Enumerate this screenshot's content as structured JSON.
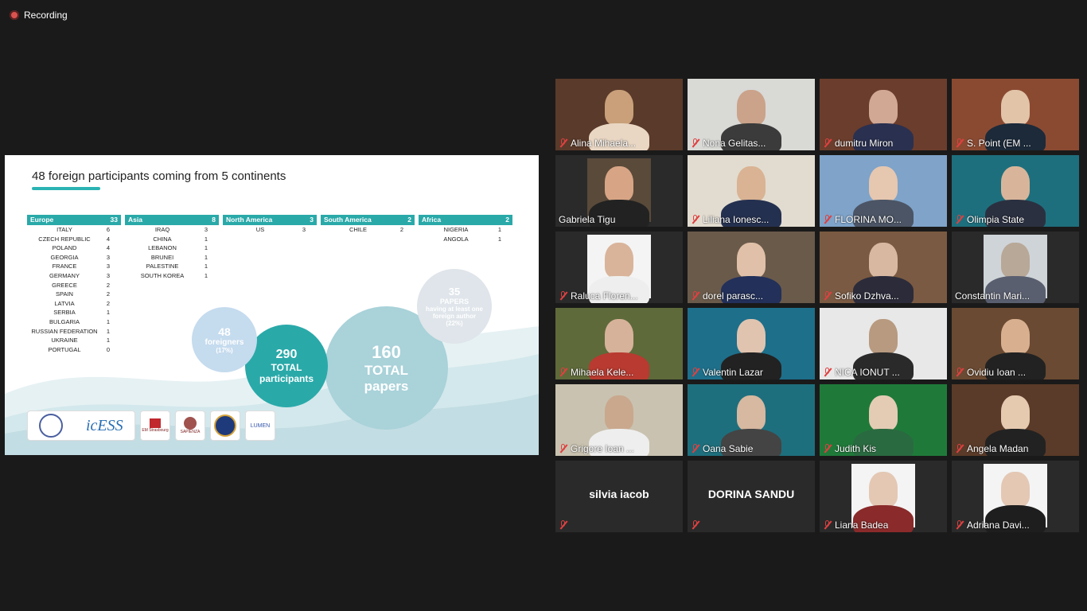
{
  "recording": {
    "label": "Recording",
    "color": "#d9534f"
  },
  "slide": {
    "title": "48 foreign participants coming from 5 continents",
    "regions": [
      {
        "name": "Europe",
        "total": "33",
        "countries": [
          {
            "name": "ITALY",
            "count": "6"
          },
          {
            "name": "CZECH REPUBLIC",
            "count": "4"
          },
          {
            "name": "POLAND",
            "count": "4"
          },
          {
            "name": "GEORGIA",
            "count": "3"
          },
          {
            "name": "FRANCE",
            "count": "3"
          },
          {
            "name": "GERMANY",
            "count": "3"
          },
          {
            "name": "GREECE",
            "count": "2"
          },
          {
            "name": "SPAIN",
            "count": "2"
          },
          {
            "name": "LATVIA",
            "count": "2"
          },
          {
            "name": "SERBIA",
            "count": "1"
          },
          {
            "name": "BULGARIA",
            "count": "1"
          },
          {
            "name": "RUSSIAN FEDERATION",
            "count": "1"
          },
          {
            "name": "UKRAINE",
            "count": "1"
          },
          {
            "name": "PORTUGAL",
            "count": "0"
          }
        ]
      },
      {
        "name": "Asia",
        "total": "8",
        "countries": [
          {
            "name": "IRAQ",
            "count": "3"
          },
          {
            "name": "CHINA",
            "count": "1"
          },
          {
            "name": "LEBANON",
            "count": "1"
          },
          {
            "name": "BRUNEI",
            "count": "1"
          },
          {
            "name": "PALESTINE",
            "count": "1"
          },
          {
            "name": "SOUTH KOREA",
            "count": "1"
          }
        ]
      },
      {
        "name": "North America",
        "total": "3",
        "countries": [
          {
            "name": "US",
            "count": "3"
          }
        ]
      },
      {
        "name": "South America",
        "total": "2",
        "countries": [
          {
            "name": "CHILE",
            "count": "2"
          }
        ]
      },
      {
        "name": "Africa",
        "total": "2",
        "countries": [
          {
            "name": "NIGERIA",
            "count": "1"
          },
          {
            "name": "ANGOLA",
            "count": "1"
          }
        ]
      }
    ],
    "stats": {
      "foreigners": {
        "value": "48",
        "label": "foreigners",
        "pct": "(17%)"
      },
      "participants": {
        "value": "290",
        "label1": "TOTAL",
        "label2": "participants"
      },
      "papers": {
        "value": "160",
        "label1": "TOTAL",
        "label2": "papers"
      },
      "foreign_papers": {
        "value": "35",
        "label1": "PAPERS",
        "label2": "having at least one foreign author",
        "pct": "(22%)"
      }
    },
    "logos": [
      "icESS",
      "EM Strasbourg",
      "SAPIENZA",
      "",
      "LUMEN"
    ],
    "accent": "#2aa9a9"
  },
  "participants": [
    {
      "name": "Alina Mihaela...",
      "muted": true
    },
    {
      "name": "Nona Gelitas...",
      "muted": true
    },
    {
      "name": "dumitru Miron",
      "muted": true
    },
    {
      "name": "S. Point (EM ...",
      "muted": true
    },
    {
      "name": "Gabriela Tigu",
      "muted": false
    },
    {
      "name": "Liliana Ionesc...",
      "muted": true
    },
    {
      "name": "FLORINA MO...",
      "muted": true
    },
    {
      "name": "Olimpia State",
      "muted": true
    },
    {
      "name": "Raluca Floren...",
      "muted": true
    },
    {
      "name": "dorel parasc...",
      "muted": true
    },
    {
      "name": "Sofiko Dzhva...",
      "muted": true
    },
    {
      "name": "Constantin Mari...",
      "muted": false,
      "active": true
    },
    {
      "name": "Mihaela Kele...",
      "muted": true
    },
    {
      "name": "Valentin Lazar",
      "muted": true
    },
    {
      "name": "NICA IONUT ...",
      "muted": true
    },
    {
      "name": "Ovidiu Ioan ...",
      "muted": true
    },
    {
      "name": "Grigore Ioan ...",
      "muted": true
    },
    {
      "name": "Oana Sabie",
      "muted": true
    },
    {
      "name": "Judith Kis",
      "muted": true
    },
    {
      "name": "Angela Madan",
      "muted": true
    },
    {
      "name": "",
      "muted": true,
      "center_name": "silvia iacob"
    },
    {
      "name": "",
      "muted": true,
      "center_name": "DORINA SANDU"
    },
    {
      "name": "Liana Badea",
      "muted": true
    },
    {
      "name": "Adriana Davi...",
      "muted": true
    }
  ]
}
